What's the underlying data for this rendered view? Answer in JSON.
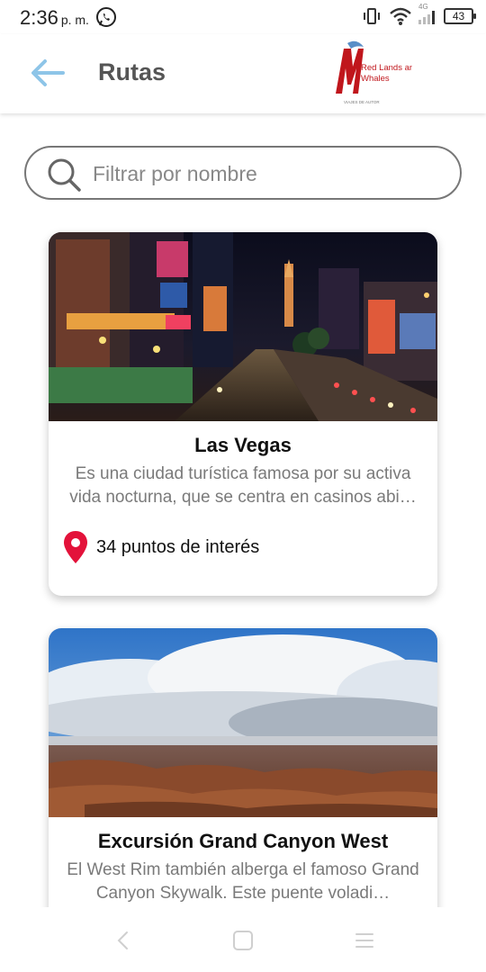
{
  "status_bar": {
    "time": "2:36",
    "ampm": "p. m.",
    "wifi_label": "4G",
    "battery": "43",
    "icons": [
      "whatsapp-icon",
      "vibrate-icon",
      "wifi-icon",
      "signal-icon",
      "battery-icon"
    ]
  },
  "header": {
    "title": "Rutas",
    "back_icon": "back-arrow-icon",
    "logo": {
      "line1": "Red Lands and",
      "line2": "Whales",
      "tagline": "VIAJES DE AUTOR"
    }
  },
  "search": {
    "placeholder": "Filtrar por nombre",
    "value": "",
    "icon": "search-icon"
  },
  "routes": [
    {
      "title": "Las Vegas",
      "description": "Es una ciudad turística famosa por su activa vida nocturna, que se centra en casinos abi…",
      "poi_text": "34 puntos de interés",
      "image": "las-vegas-night-strip"
    },
    {
      "title": "Excursión Grand Canyon West",
      "description": "El West Rim también alberga el famoso Grand Canyon Skywalk. Este puente voladi…",
      "image": "grand-canyon-clouds"
    }
  ],
  "colors": {
    "accent": "#8ec5e8",
    "pin": "#e3123a",
    "title_gray": "#555555",
    "desc_gray": "#7a7a7a"
  },
  "nav": {
    "icons": [
      "nav-back-icon",
      "nav-home-icon",
      "nav-menu-icon"
    ]
  }
}
